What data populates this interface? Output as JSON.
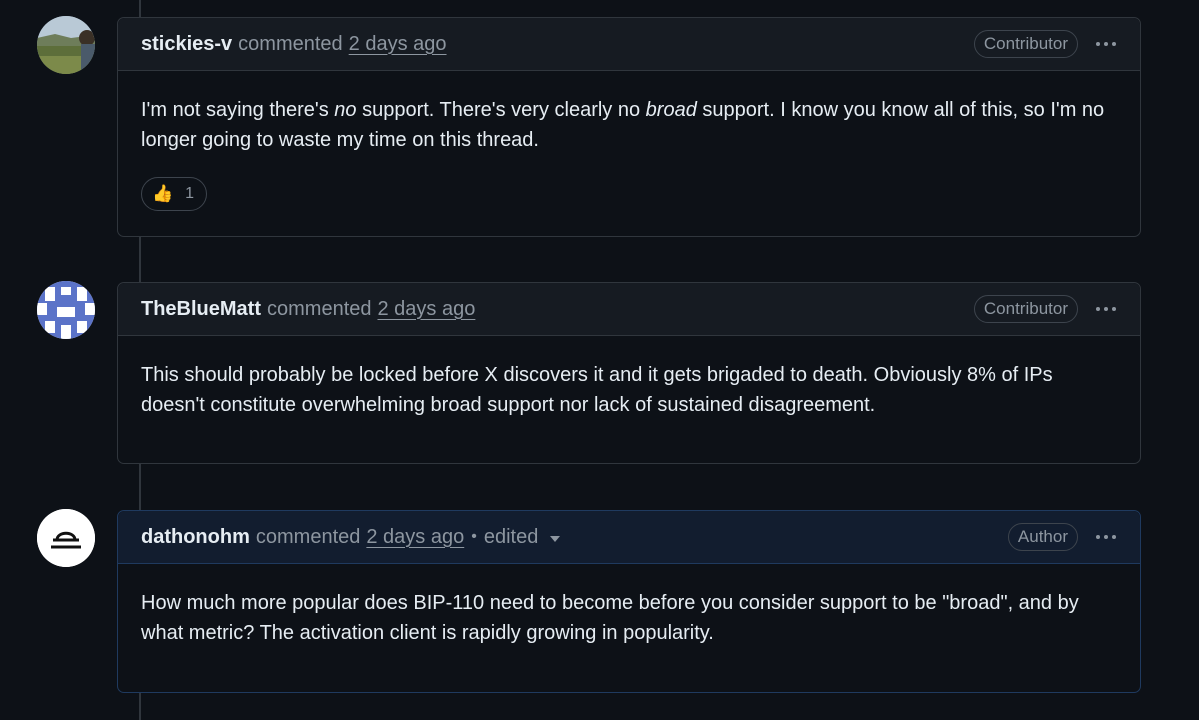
{
  "comments": [
    {
      "username": "stickies-v",
      "verb": "commented",
      "time": "2 days ago",
      "badge": "Contributor",
      "body_parts": {
        "p1": "I'm not saying there's ",
        "em1": "no",
        "p2": " support. There's very clearly no ",
        "em2": "broad",
        "p3": " support. I know you know all of this, so I'm no longer going to waste my time on this thread."
      },
      "reaction": {
        "icon": "👍",
        "count": "1"
      }
    },
    {
      "username": "TheBlueMatt",
      "verb": "commented",
      "time": "2 days ago",
      "badge": "Contributor",
      "body": "This should probably be locked before X discovers it and it gets brigaded to death. Obviously 8% of IPs doesn't constitute overwhelming broad support nor lack of sustained disagreement."
    },
    {
      "username": "dathonohm",
      "verb": "commented",
      "time": "2 days ago",
      "separator": "•",
      "edited": "edited",
      "badge": "Author",
      "body": "How much more popular does BIP-110 need to become before you consider support to be \"broad\", and by what metric? The activation client is rapidly growing in popularity."
    }
  ],
  "colors": {
    "background": "#0d1117",
    "header": "#161b22",
    "author_header": "#121d2f",
    "border": "#30363d",
    "muted": "#8d96a0"
  },
  "icons": {
    "more": "kebab-horizontal-icon",
    "edited_dropdown": "triangle-down-icon",
    "reaction": "thumbs-up-icon"
  }
}
